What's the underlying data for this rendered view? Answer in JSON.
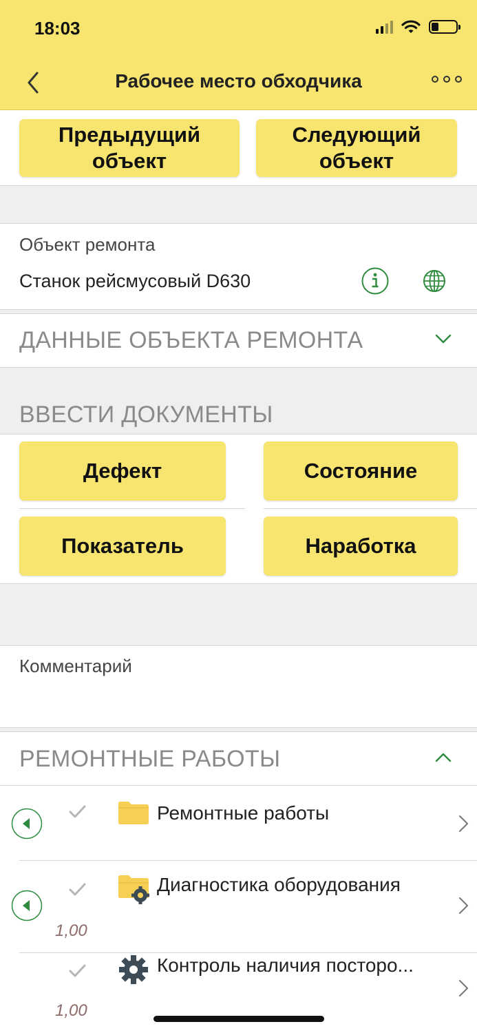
{
  "status": {
    "time": "18:03"
  },
  "nav": {
    "title": "Рабочее место обходчика"
  },
  "top_buttons": {
    "prev": "Предыдущий объект",
    "next": "Следующий объект"
  },
  "repair_object": {
    "label": "Объект ремонта",
    "value": "Станок рейсмусовый D630"
  },
  "sections": {
    "object_data": "ДАННЫЕ ОБЪЕКТА РЕМОНТА",
    "enter_documents": "ВВЕСТИ ДОКУМЕНТЫ",
    "repair_works": "РЕМОНТНЫЕ РАБОТЫ"
  },
  "document_buttons": {
    "defect": "Дефект",
    "state": "Состояние",
    "indicator": "Показатель",
    "operating_time": "Наработка"
  },
  "comment": {
    "label": "Комментарий"
  },
  "tree_items": [
    {
      "label": "Ремонтные работы",
      "icon": "folder-icon",
      "number": ""
    },
    {
      "label": "Диагностика оборудования",
      "icon": "folder-gear-icon",
      "number": "1,00"
    },
    {
      "label": "Контроль наличия посторо...",
      "icon": "gear-icon",
      "number": "1,00"
    }
  ],
  "colors": {
    "accent_yellow": "#f7e56f",
    "green": "#2e8b3d"
  }
}
